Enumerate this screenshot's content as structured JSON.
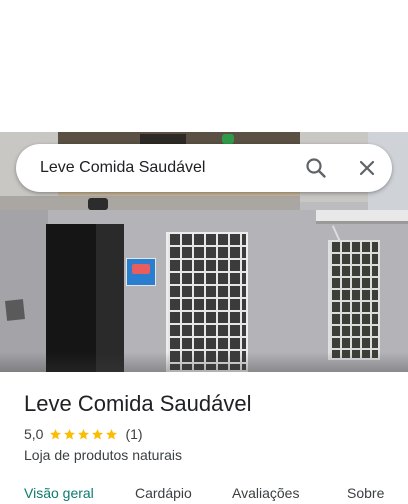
{
  "search": {
    "query": "Leve Comida Saudável"
  },
  "place": {
    "name": "Leve Comida Saudável",
    "rating": "5,0",
    "stars": 5,
    "review_count": "(1)",
    "category": "Loja de produtos naturais"
  },
  "tabs": [
    {
      "label": "Visão geral",
      "active": true
    },
    {
      "label": "Cardápio",
      "active": false
    },
    {
      "label": "Avaliações",
      "active": false
    },
    {
      "label": "Sobre",
      "active": false
    }
  ],
  "colors": {
    "star": "#fbbc04",
    "active_tab": "#0b7a6e",
    "icon": "#5f6368"
  },
  "icons": {
    "search": "search-icon",
    "close": "close-icon",
    "star": "star-icon"
  }
}
